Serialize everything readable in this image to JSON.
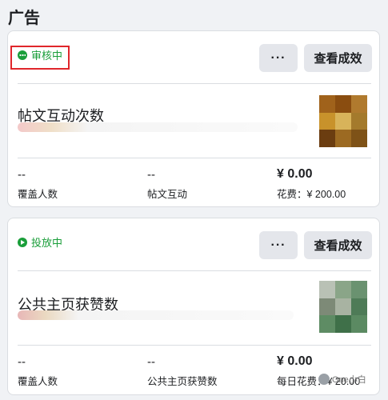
{
  "section": {
    "title": "广告"
  },
  "cards": [
    {
      "status": "审核中",
      "more_label": "···",
      "results_label": "查看成效",
      "metric_title": "帖文互动次数",
      "stats": [
        {
          "value": "--",
          "label": "覆盖人数"
        },
        {
          "value": "--",
          "label": "帖文互动"
        },
        {
          "value": "¥ 0.00",
          "label": "花费：¥ 200.00"
        }
      ]
    },
    {
      "status": "投放中",
      "more_label": "···",
      "results_label": "查看成效",
      "metric_title": "公共主页获赞数",
      "stats": [
        {
          "value": "--",
          "label": "覆盖人数"
        },
        {
          "value": "--",
          "label": "公共主页获赞数"
        },
        {
          "value": "¥ 0.00",
          "label": "每日花费：¥ 20.00"
        }
      ]
    }
  ],
  "watermark": "One小白",
  "colors": {
    "status_green": "#1a9e3a",
    "highlight_red": "#e0262b",
    "button_gray": "#e4e6eb"
  }
}
